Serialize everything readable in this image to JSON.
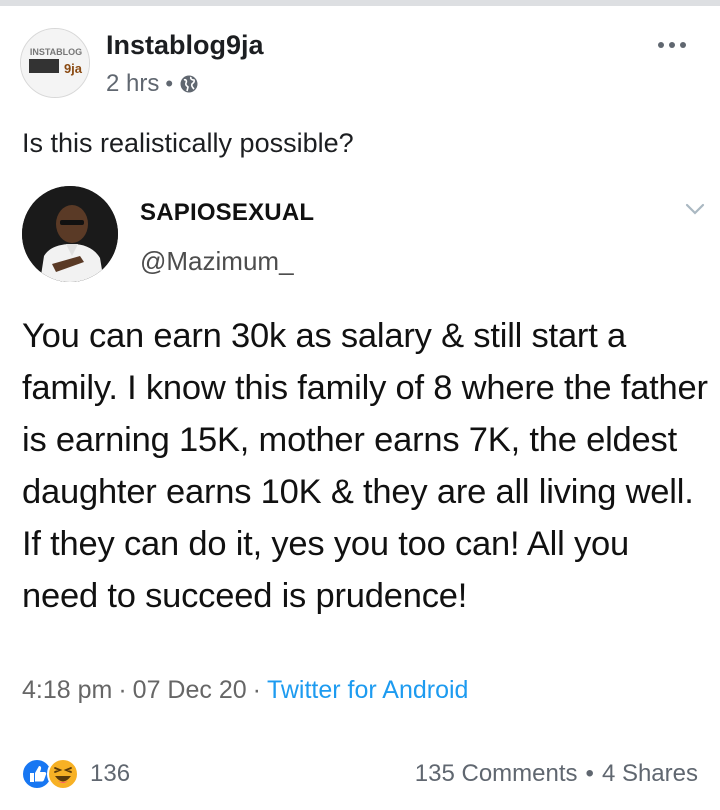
{
  "post": {
    "page_name": "Instablog9ja",
    "time_ago": "2 hrs",
    "separator": "•",
    "privacy_icon": "globe-icon",
    "more_icon": "more-options-icon",
    "avatar_logo_text": "INSTABLOG",
    "avatar_logo_text2": "9ja",
    "caption": "Is this realistically possible?"
  },
  "tweet": {
    "display_name": "SAPIOSEXUAL",
    "handle": "@Mazimum_",
    "chevron_icon": "chevron-down-icon",
    "body": "You can earn 30k as salary & still start a family. I know this family of 8 where the father is earning 15K, mother earns 7K, the eldest daughter earns 10K & they are all living well. If they can do it, yes you too can! All you need to succeed is prudence!",
    "time": "4:18 pm",
    "sep1": "·",
    "date": "07 Dec 20",
    "sep2": "·",
    "source": "Twitter for Android"
  },
  "reactions": {
    "icons": [
      "like-icon",
      "haha-icon"
    ],
    "count": "136",
    "comments": "135 Comments",
    "separator": "•",
    "shares": "4 Shares"
  },
  "colors": {
    "link_blue": "#1d9bf0",
    "like_blue": "#1877f2",
    "haha_yellow": "#f7b125",
    "meta_gray": "#606770"
  }
}
